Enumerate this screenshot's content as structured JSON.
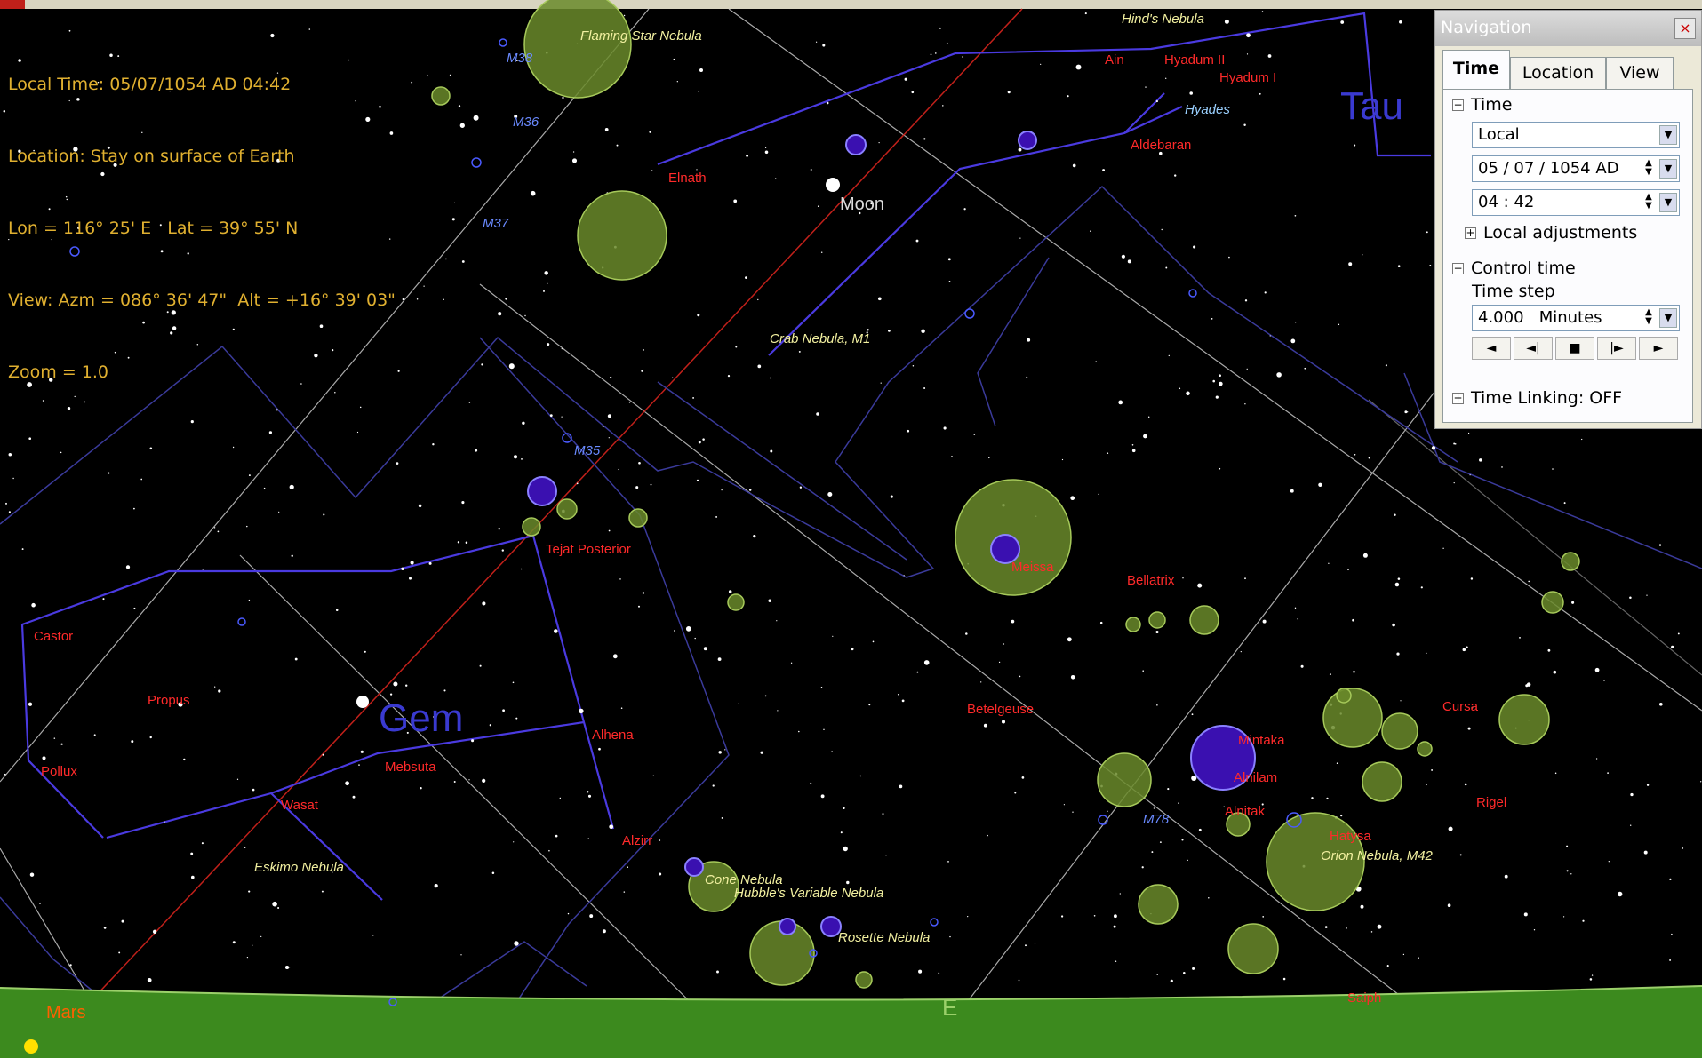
{
  "hud": {
    "local_time": "Local Time: 05/07/1054 AD 04:42",
    "location": "Location: Stay on surface of Earth",
    "lonlat": "Lon = 116° 25' E   Lat = 39° 55' N",
    "view": "View: Azm = 086° 36' 47\"  Alt = +16° 39' 03\"",
    "zoom": "Zoom = 1.0"
  },
  "navigation": {
    "title": "Navigation",
    "close": "×",
    "tabs": [
      "Time",
      "Location",
      "View"
    ],
    "time_section": "Time",
    "time_mode": "Local",
    "date": "05 / 07 / 1054 AD",
    "clock": "04 : 42",
    "local_adjustments": "Local adjustments",
    "control_section": "Control time",
    "time_step_label": "Time step",
    "time_step_value": "4.000",
    "time_step_unit": "Minutes",
    "transport": [
      "◄",
      "◄|",
      "■",
      "|►",
      "►"
    ],
    "time_linking": "Time Linking: OFF"
  },
  "sky": {
    "colors": {
      "background": "#000000",
      "horizon": "#3c8a1e",
      "constellation": "#4a3ae0",
      "star_label": "#ff2a2a",
      "nebula_label": "#f2f0a0",
      "planet_label": "#ff6000",
      "boundary": "#3a3a9a",
      "grid": "#bdbdbd"
    },
    "constellations": [
      "Tau",
      "Gem"
    ],
    "moon": "Moon",
    "planet": "Mars",
    "horizon_marker": "E",
    "stars": [
      "Elnath",
      "Aldebaran",
      "Hyadum I",
      "Hyadum II",
      "Ain",
      "Castor",
      "Propus",
      "Pollux",
      "Wasat",
      "Mebsuta",
      "Tejat Posterior",
      "Alhena",
      "Alzirr",
      "Betelgeuse",
      "Bellatrix",
      "Meissa",
      "Mintaka",
      "Alnitak",
      "Alnilam",
      "Rigel",
      "Cursa",
      "Saiph",
      "Hatysa",
      "Hyades"
    ],
    "nebulae": [
      "Hind's Nebula",
      "Flaming Star Nebula",
      "Crab Nebula, M1",
      "Eskimo Nebula",
      "Cone Nebula",
      "Hubble's Variable Nebula",
      "Rosette Nebula",
      "Orion Nebula, M42",
      "M78",
      "M38",
      "M36",
      "M37",
      "M35"
    ]
  }
}
